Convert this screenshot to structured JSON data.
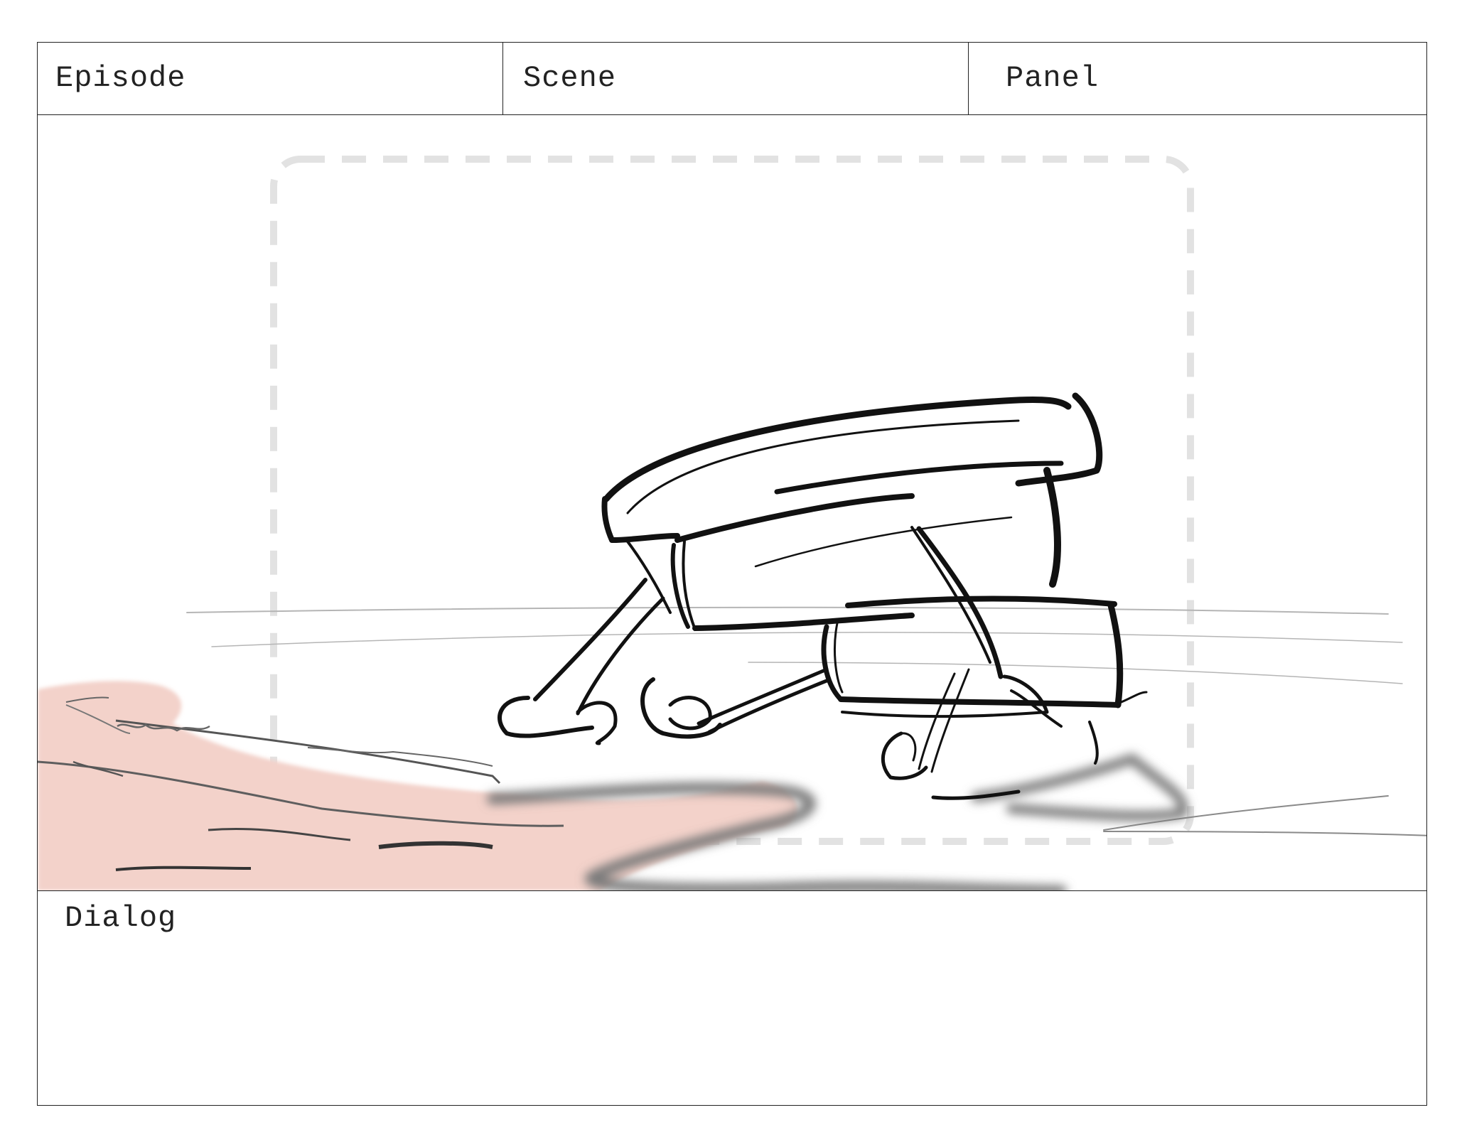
{
  "header": {
    "episode_label": "Episode",
    "scene_label": "Scene",
    "panel_label": "Panel"
  },
  "dialog": {
    "label": "Dialog"
  },
  "colors": {
    "frame_border": "#222222",
    "safe_area_guide": "#e2e2e2",
    "skin_tint": "#f3d2ca",
    "ink": "#111111",
    "shadow": "#7a7a7a",
    "horizon": "#b5b5b5"
  }
}
